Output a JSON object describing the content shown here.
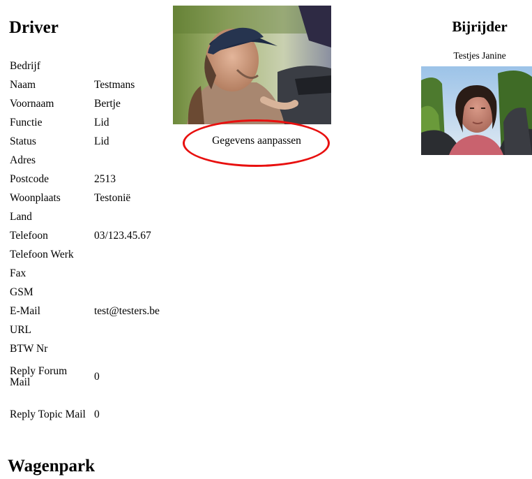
{
  "driver": {
    "title": "Driver",
    "fields": [
      {
        "label": "Bedrijf",
        "value": ""
      },
      {
        "label": "Naam",
        "value": "Testmans"
      },
      {
        "label": "Voornaam",
        "value": "Bertje"
      },
      {
        "label": "Functie",
        "value": "Lid"
      },
      {
        "label": "Status",
        "value": "Lid"
      },
      {
        "label": "Adres",
        "value": ""
      },
      {
        "label": "Postcode",
        "value": "2513"
      },
      {
        "label": "Woonplaats",
        "value": "Testonië"
      },
      {
        "label": "Land",
        "value": ""
      },
      {
        "label": "Telefoon",
        "value": "03/123.45.67"
      },
      {
        "label": "Telefoon Werk",
        "value": ""
      },
      {
        "label": "Fax",
        "value": ""
      },
      {
        "label": "GSM",
        "value": ""
      },
      {
        "label": "E-Mail",
        "value": "test@testers.be"
      },
      {
        "label": "URL",
        "value": ""
      },
      {
        "label": "BTW Nr",
        "value": ""
      },
      {
        "label": "Reply Forum Mail",
        "value": "0"
      },
      {
        "label": "Reply Topic Mail",
        "value": "0"
      }
    ]
  },
  "edit_profile_label": "Gegevens aanpassen",
  "codriver": {
    "title": "Bijrijder",
    "name": "Testjes Janine"
  },
  "fleet": {
    "title": "Wagenpark"
  },
  "colors": {
    "highlight_circle": "#e8100f"
  }
}
